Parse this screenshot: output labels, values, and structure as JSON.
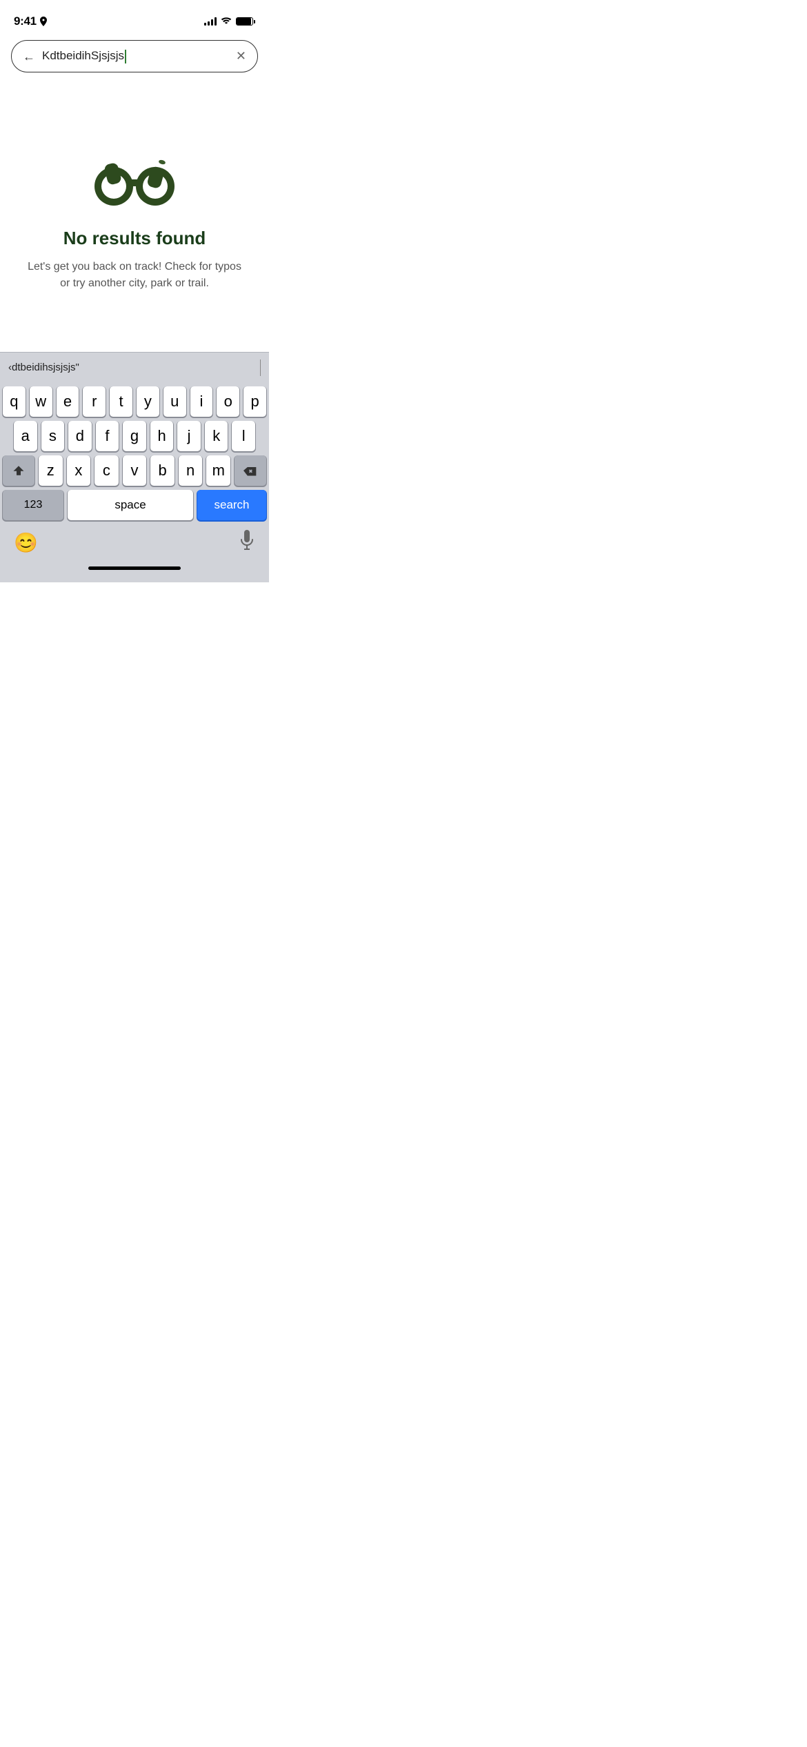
{
  "statusBar": {
    "time": "9:41",
    "locationIcon": "▲"
  },
  "searchBar": {
    "backArrow": "←",
    "inputValue": "KdtbeidihSjsjsjs",
    "clearIcon": "✕"
  },
  "emptyState": {
    "title": "No results found",
    "subtitle": "Let's get you back on track! Check for typos or try another city, park or trail."
  },
  "suggestion": {
    "text": "‹dtbeidihsjsjsjs\""
  },
  "keyboard": {
    "row1": [
      "q",
      "w",
      "e",
      "r",
      "t",
      "y",
      "u",
      "i",
      "o",
      "p"
    ],
    "row2": [
      "a",
      "s",
      "d",
      "f",
      "g",
      "h",
      "j",
      "k",
      "l"
    ],
    "row3": [
      "z",
      "x",
      "c",
      "v",
      "b",
      "n",
      "m"
    ],
    "bottomRow": {
      "numbersLabel": "123",
      "spaceLabel": "space",
      "searchLabel": "search"
    }
  }
}
